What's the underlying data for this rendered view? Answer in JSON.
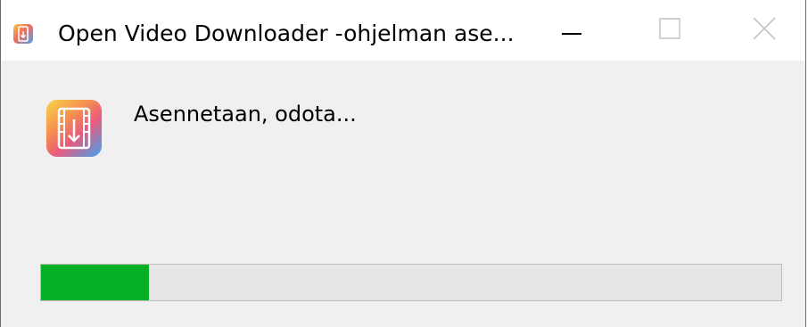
{
  "window": {
    "title": "Open Video Downloader -ohjelman ase...",
    "icon": "video-downloader-app-icon",
    "controls": {
      "minimize_icon": "minimize-icon",
      "maximize_icon": "maximize-icon",
      "close_icon": "close-icon"
    }
  },
  "content": {
    "app_icon": "video-downloader-app-icon",
    "status": "Asennetaan, odota..."
  },
  "progress": {
    "value_fraction": 0.146,
    "fill_color": "#06b025",
    "track_color": "#e6e6e6"
  }
}
